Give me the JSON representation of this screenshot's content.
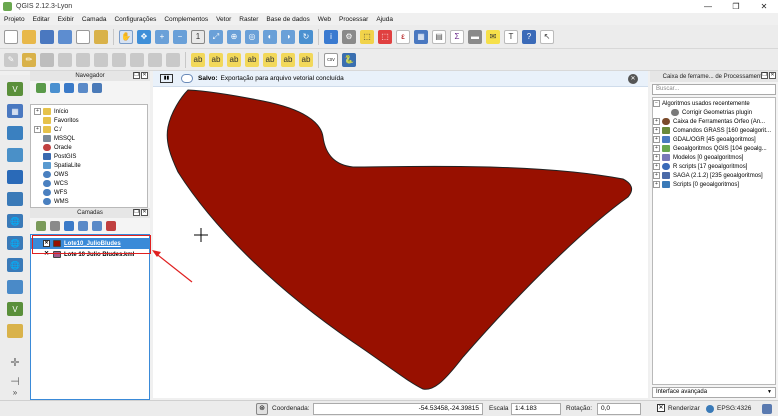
{
  "window": {
    "title": "QGIS 2.12.3-Lyon",
    "controls": [
      "—",
      "❐",
      "✕"
    ]
  },
  "menu": [
    "Projeto",
    "Editar",
    "Exibir",
    "Camada",
    "Configurações",
    "Complementos",
    "Vetor",
    "Raster",
    "Base de dados",
    "Web",
    "Processar",
    "Ajuda"
  ],
  "message": {
    "title": "Salvo:",
    "text": "Exportação para arquivo vetorial concluída"
  },
  "browser": {
    "title": "Navegador",
    "items": [
      "Início",
      "Favoritos",
      "C:/",
      "MSSQL",
      "Oracle",
      "PostGIS",
      "SpatiaLite",
      "OWS",
      "WCS",
      "WFS",
      "WMS"
    ]
  },
  "layers": {
    "title": "Camadas",
    "items": [
      {
        "name": "Lote10_JulioBludes",
        "checked": true,
        "selected": true
      },
      {
        "name": "Lote 10 Julio Bludes.kml",
        "checked": true,
        "selected": false
      }
    ]
  },
  "processing": {
    "title": "Caixa de ferrame... de Processamento",
    "search_placeholder": "Buscar...",
    "items": [
      {
        "label": "Algoritmos usados recentemente",
        "expanded": true,
        "level": 0
      },
      {
        "label": "Corrigir Geometrias plugin",
        "level": 1
      },
      {
        "label": "Caixa de Ferramentas Orfeo (An...",
        "level": 0
      },
      {
        "label": "Comandos GRASS [160 geoalgorit...",
        "level": 0
      },
      {
        "label": "GDAL/OGR [45 geoalgoritmos]",
        "level": 0
      },
      {
        "label": "Geoalgoritmos QGIS [104 geoalg...",
        "level": 0
      },
      {
        "label": "Modelos [0 geoalgoritmos]",
        "level": 0
      },
      {
        "label": "R scripts [17 geoalgoritmos]",
        "level": 0
      },
      {
        "label": "SAGA (2.1.2) [235 geoalgoritmos]",
        "level": 0
      },
      {
        "label": "Scripts [0 geoalgoritmos]",
        "level": 0
      }
    ],
    "mode": "Interface avançada"
  },
  "status": {
    "coord_label": "Coordenada:",
    "coord_value": "-54.53458,-24.39815",
    "scale_label": "Escala",
    "scale_value": "1:4.183",
    "rotation_label": "Rotação:",
    "rotation_value": "0,0",
    "render_label": "Renderizar",
    "crs": "EPSG:4326"
  },
  "colors": {
    "polygon_fill": "#981000",
    "annotation": "#e02020",
    "message_bg": "#e9f1fa"
  }
}
